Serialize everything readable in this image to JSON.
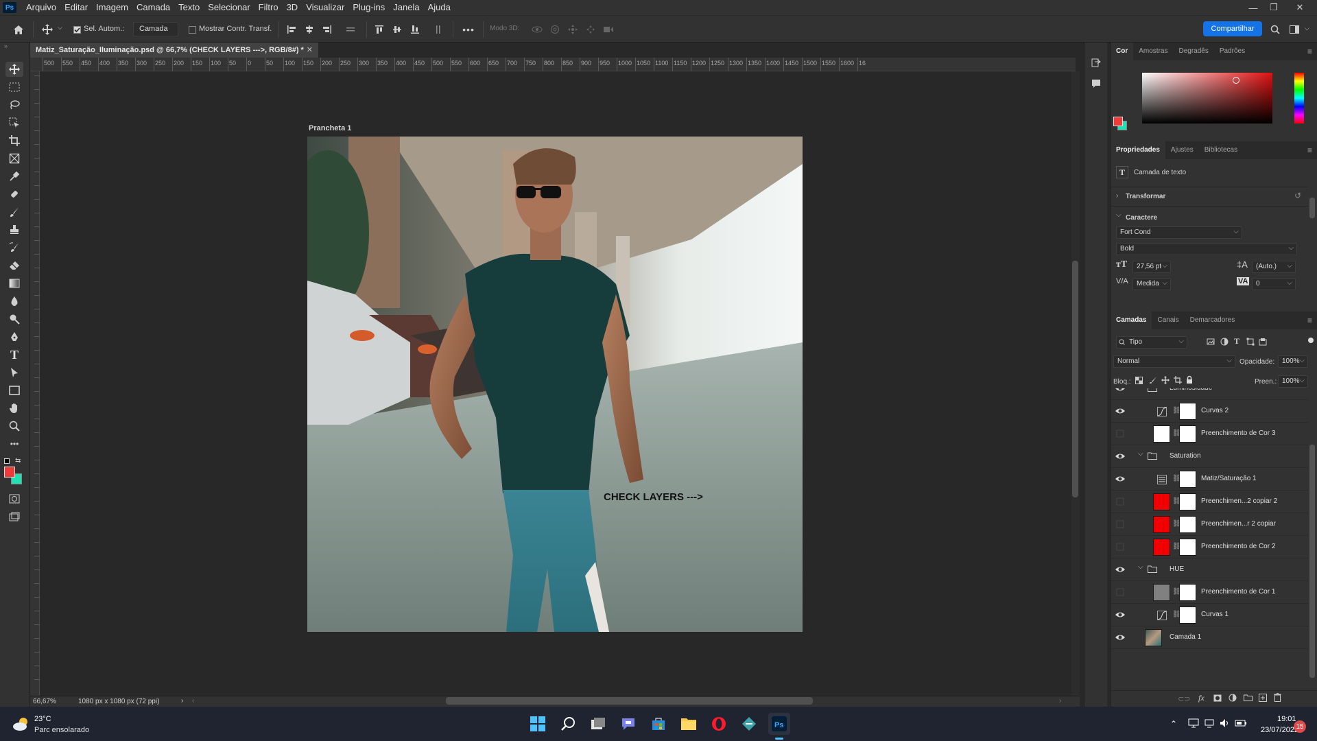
{
  "app": {
    "logo_text": "Ps"
  },
  "menu": [
    "Arquivo",
    "Editar",
    "Imagem",
    "Camada",
    "Texto",
    "Selecionar",
    "Filtro",
    "3D",
    "Visualizar",
    "Plug-ins",
    "Janela",
    "Ajuda"
  ],
  "options": {
    "auto_select_label": "Sel. Autom.:",
    "auto_select_target": "Camada",
    "show_transform_label": "Mostrar Contr. Transf.",
    "mode3d_label": "Modo 3D:",
    "share_label": "Compartilhar"
  },
  "document": {
    "tab_title": "Matiz_Saturação_Iluminação.psd @ 66,7% (CHECK LAYERS --->, RGB/8#) *",
    "artboard_label": "Prancheta 1",
    "overlay_text": "CHECK LAYERS --->",
    "ruler_ticks": [
      "500",
      "550",
      "450",
      "400",
      "350",
      "300",
      "250",
      "200",
      "150",
      "100",
      "50",
      "0",
      "50",
      "100",
      "150",
      "200",
      "250",
      "300",
      "350",
      "400",
      "450",
      "500",
      "550",
      "600",
      "650",
      "700",
      "750",
      "800",
      "850",
      "900",
      "950",
      "1000",
      "1050",
      "1100",
      "1150",
      "1200",
      "1250",
      "1300",
      "1350",
      "1400",
      "1450",
      "1500",
      "1550",
      "1600",
      "16"
    ]
  },
  "status": {
    "zoom": "66,67%",
    "size": "1080 px x 1080 px (72 ppi)"
  },
  "color_panel": {
    "tabs": [
      "Cor",
      "Amostras",
      "Degradês",
      "Padrões"
    ],
    "foreground": "#f03b3b",
    "background": "#21e0b4"
  },
  "properties": {
    "tabs": [
      "Propriedades",
      "Ajustes",
      "Bibliotecas"
    ],
    "layer_type": "Camada de texto",
    "transform_label": "Transformar",
    "character_label": "Caractere",
    "font_family": "Fort Cond",
    "font_style": "Bold",
    "font_size": "27,56 pt",
    "leading": "(Auto.)",
    "kerning": "Medida",
    "tracking": "0"
  },
  "layers_panel": {
    "tabs": [
      "Camadas",
      "Canais",
      "Demarcadores"
    ],
    "filter": "Tipo",
    "blend_mode": "Normal",
    "opacity_label": "Opacidade:",
    "opacity": "100%",
    "lock_label": "Bloq.:",
    "fill_label": "Preen.:",
    "fill": "100%",
    "layers": [
      {
        "name": "Luminosidade",
        "kind": "group",
        "visible": true
      },
      {
        "name": "Curvas 2",
        "kind": "curves",
        "visible": true
      },
      {
        "name": "Preenchimento de Cor 3",
        "kind": "fill-white",
        "visible": false
      },
      {
        "name": "Saturation",
        "kind": "group",
        "visible": true
      },
      {
        "name": "Matiz/Saturação 1",
        "kind": "huesat",
        "visible": true
      },
      {
        "name": "Preenchimen...2 copiar 2",
        "kind": "fill-red",
        "visible": false
      },
      {
        "name": "Preenchimen...r 2 copiar",
        "kind": "fill-red",
        "visible": false
      },
      {
        "name": "Preenchimento de Cor 2",
        "kind": "fill-red",
        "visible": false
      },
      {
        "name": "HUE",
        "kind": "group",
        "visible": true
      },
      {
        "name": "Preenchimento de Cor 1",
        "kind": "fill-gray",
        "visible": false
      },
      {
        "name": "Curvas 1",
        "kind": "curves",
        "visible": true
      },
      {
        "name": "Camada 1",
        "kind": "photo",
        "visible": true
      }
    ]
  },
  "taskbar": {
    "weather_temp": "23°C",
    "weather_desc": "Parc ensolarado",
    "time": "19:01",
    "date": "23/07/2022",
    "notifications": "15"
  }
}
